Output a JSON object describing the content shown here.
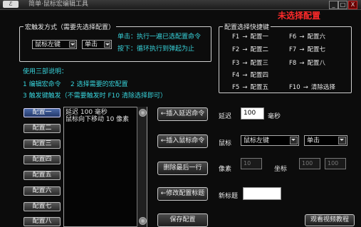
{
  "window": {
    "title": "简单·鼠标宏编辑工具",
    "icon_glyph": "ℰ",
    "minimize": "_",
    "maximize": "□",
    "close": "X"
  },
  "status": {
    "text": "未选择配置",
    "color": "#ff2a2a"
  },
  "trigger_group": {
    "title": "宏触发方式（需要先选择配置）",
    "mouse_select": "鼠标左键",
    "mode_select": "单击",
    "hint_click": "单击：执行一遍已选配置命令",
    "hint_hold": "按下：循环执行到弹起为止"
  },
  "shortcut_group": {
    "title": "配置选择快捷键",
    "items": [
      {
        "key": "F1",
        "target": "配置一"
      },
      {
        "key": "F2",
        "target": "配置二"
      },
      {
        "key": "F3",
        "target": "配置三"
      },
      {
        "key": "F4",
        "target": "配置四"
      },
      {
        "key": "F5",
        "target": "配置五"
      },
      {
        "key": "F6",
        "target": "配置六"
      },
      {
        "key": "F7",
        "target": "配置七"
      },
      {
        "key": "F8",
        "target": "配置八"
      },
      {
        "key": "F10",
        "target": "清除选择"
      }
    ],
    "arrow": "→"
  },
  "usage": {
    "title": "使用三部说明：",
    "step1": "1 编辑宏命令",
    "step2": "2 选择需要的宏配置",
    "step3": "3 触发键触发（不需要触发时 F10 清除选择即可）"
  },
  "configs": [
    "配置一",
    "配置二",
    "配置三",
    "配置四",
    "配置五",
    "配置六",
    "配置七",
    "配置八"
  ],
  "command_list": [
    "延迟 100 毫秒",
    "鼠标向下移动 10 像素"
  ],
  "actions": {
    "insert_delay": "←插入延迟命令",
    "insert_mouse": "←插入鼠标命令",
    "delete_last": "删除最后一行",
    "modify_title": "←修改配置标题",
    "save_config": "保存配置"
  },
  "form": {
    "delay_label": "延迟",
    "delay_value": "100",
    "delay_unit": "毫秒",
    "mouse_label": "鼠标",
    "mouse_select": "鼠标左键",
    "mouse_mode": "单击",
    "pixel_label": "像素",
    "pixel_value": "10",
    "coord_label": "坐标",
    "coord_x": "100",
    "coord_y": "100",
    "new_title_label": "新标题",
    "new_title_value": ""
  },
  "tutorial_button": "观看视频教程"
}
